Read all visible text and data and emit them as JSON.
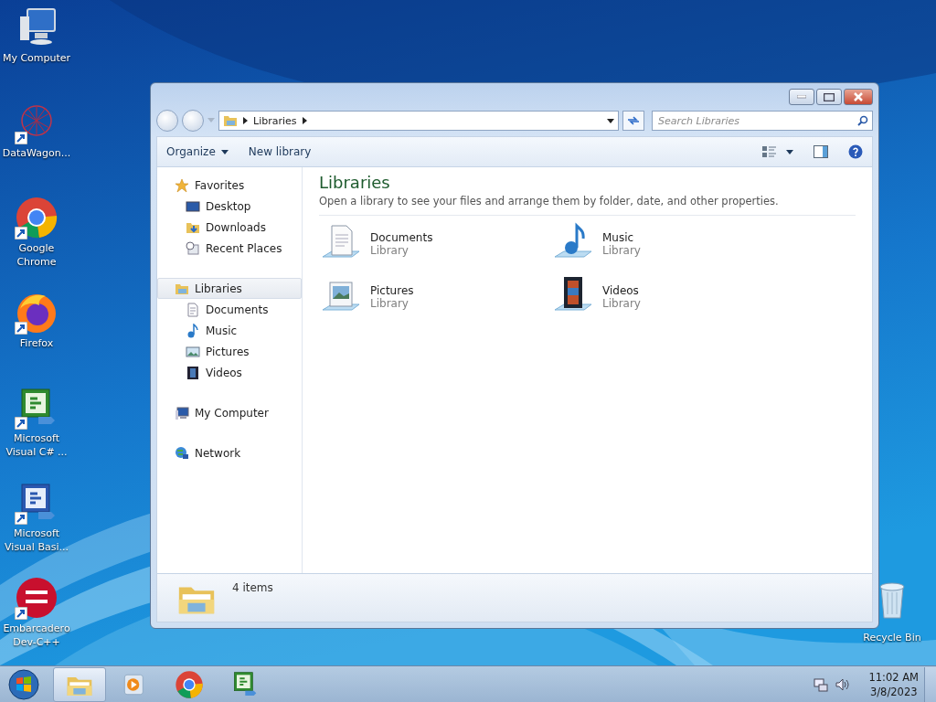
{
  "desktop_icons": [
    {
      "label": "My Computer",
      "kind": "computer",
      "shortcut": false
    },
    {
      "label": "DataWagon...",
      "kind": "datawagon",
      "shortcut": true
    },
    {
      "label": "Google Chrome",
      "kind": "chrome",
      "shortcut": true
    },
    {
      "label": "Firefox",
      "kind": "firefox",
      "shortcut": true
    },
    {
      "label": "Microsoft Visual C# ...",
      "kind": "csharp",
      "shortcut": true
    },
    {
      "label": "Microsoft Visual Basi...",
      "kind": "vb",
      "shortcut": true
    },
    {
      "label": "Embarcadero Dev-C++",
      "kind": "devcpp",
      "shortcut": true
    }
  ],
  "recycle_bin": {
    "label": "Recycle Bin"
  },
  "window": {
    "address": {
      "crumbs": [
        "Libraries"
      ]
    },
    "search": {
      "placeholder": "Search Libraries"
    },
    "toolbar": [
      {
        "label": "Organize",
        "dropdown": true
      },
      {
        "label": "New library",
        "dropdown": false
      }
    ],
    "nav": [
      {
        "label": "Favorites",
        "kind": "star",
        "selected": false,
        "children": [
          {
            "label": "Desktop",
            "kind": "desktop",
            "selected": false
          },
          {
            "label": "Downloads",
            "kind": "downloads",
            "selected": false
          },
          {
            "label": "Recent Places",
            "kind": "recent",
            "selected": false
          }
        ]
      },
      {
        "label": "Libraries",
        "kind": "libraries",
        "selected": true,
        "children": [
          {
            "label": "Documents",
            "kind": "documents",
            "selected": false
          },
          {
            "label": "Music",
            "kind": "music",
            "selected": false
          },
          {
            "label": "Pictures",
            "kind": "pictures",
            "selected": false
          },
          {
            "label": "Videos",
            "kind": "videos",
            "selected": false
          }
        ]
      },
      {
        "label": "My Computer",
        "kind": "computer",
        "selected": false
      },
      {
        "label": "Network",
        "kind": "network",
        "selected": false
      }
    ],
    "content": {
      "title": "Libraries",
      "subtitle": "Open a library to see your files and arrange them by folder, date, and other properties.",
      "items": [
        {
          "name": "Documents",
          "type": "Library",
          "kind": "documents"
        },
        {
          "name": "Music",
          "type": "Library",
          "kind": "music"
        },
        {
          "name": "Pictures",
          "type": "Library",
          "kind": "pictures"
        },
        {
          "name": "Videos",
          "type": "Library",
          "kind": "videos"
        }
      ]
    },
    "details": {
      "count": "4 items"
    }
  },
  "taskbar": {
    "items": [
      {
        "kind": "explorer",
        "selected": true
      },
      {
        "kind": "media",
        "selected": false
      },
      {
        "kind": "chrome",
        "selected": false
      },
      {
        "kind": "csharp",
        "selected": false
      }
    ],
    "time": "11:02 AM",
    "date": "3/8/2023"
  }
}
